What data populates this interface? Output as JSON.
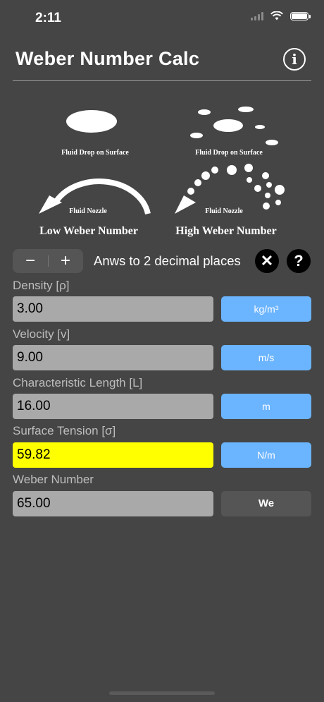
{
  "status": {
    "time": "2:11"
  },
  "header": {
    "title": "Weber Number Calc",
    "info_icon": "info-icon"
  },
  "diagram": {
    "drop_caption_left": "Fluid Drop on Surface",
    "nozzle_caption_left": "Fluid Nozzle",
    "low_label": "Low Weber Number",
    "drop_caption_right": "Fluid Drop on Surface",
    "nozzle_caption_right": "Fluid Nozzle",
    "high_label": "High Weber Number"
  },
  "controls": {
    "minus": "−",
    "plus": "+",
    "decimals_label": "Anws to 2 decimal places",
    "clear": "✕",
    "help": "?"
  },
  "fields": [
    {
      "label": "Density [ρ]",
      "value": "3.00",
      "unit": "kg/m³"
    },
    {
      "label": "Velocity [v]",
      "value": "9.00",
      "unit": "m/s"
    },
    {
      "label": "Characteristic Length [L]",
      "value": "16.00",
      "unit": "m"
    },
    {
      "label": "Surface Tension [σ]",
      "value": "59.82",
      "unit": "N/m"
    },
    {
      "label": "Weber Number",
      "value": "65.00",
      "unit": "We"
    }
  ],
  "colors": {
    "background": "#454545",
    "input": "#a9a9a9",
    "highlight": "#ffff00",
    "unit_button": "#6bb4ff"
  }
}
